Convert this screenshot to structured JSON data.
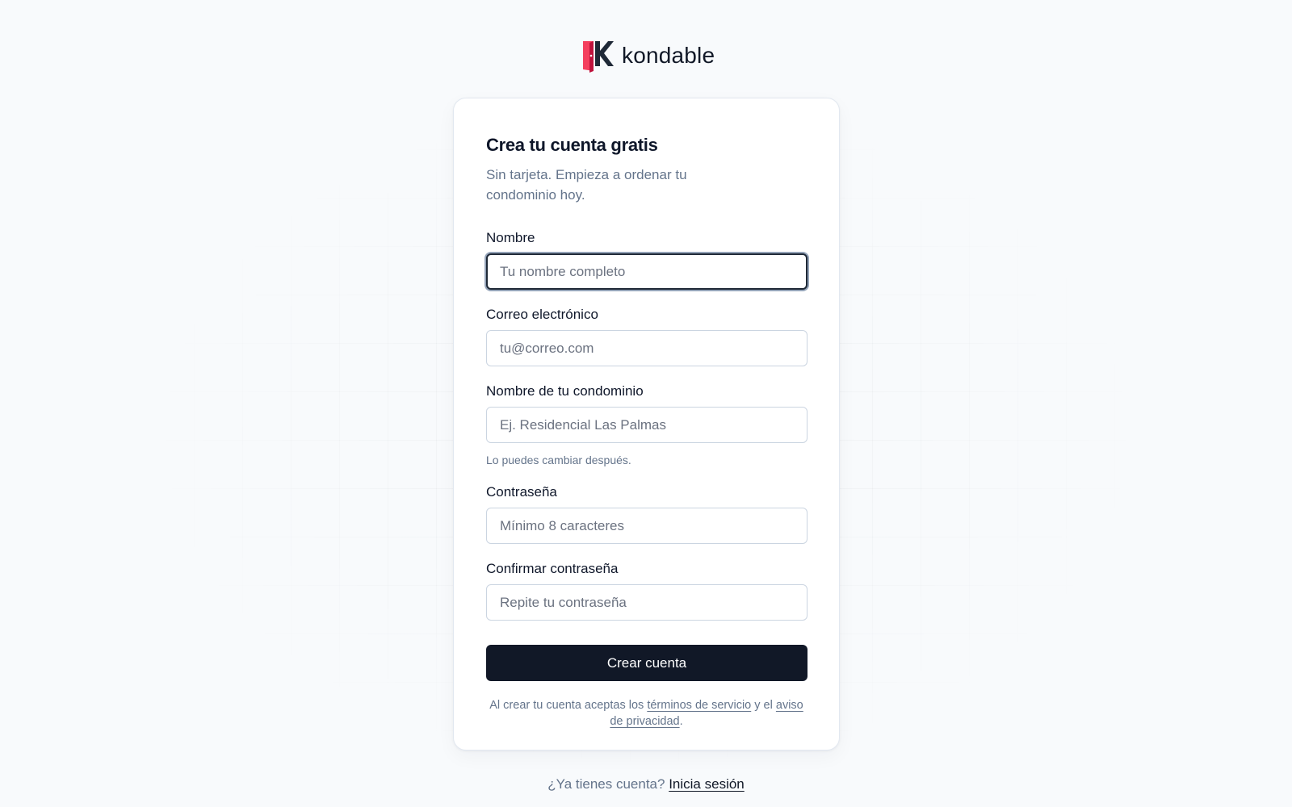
{
  "brand": {
    "name": "kondable",
    "colors": {
      "accent": "#f43f5e",
      "dark": "#111827"
    }
  },
  "card": {
    "title": "Crea tu cuenta gratis",
    "subtitle": "Sin tarjeta. Empieza a ordenar tu condominio hoy."
  },
  "form": {
    "fields": [
      {
        "label": "Nombre",
        "placeholder": "Tu nombre completo",
        "value": "",
        "focused": true
      },
      {
        "label": "Correo electrónico",
        "placeholder": "tu@correo.com",
        "value": ""
      },
      {
        "label": "Nombre de tu condominio",
        "placeholder": "Ej. Residencial Las Palmas",
        "value": "",
        "hint": "Lo puedes cambiar después."
      },
      {
        "label": "Contraseña",
        "placeholder": "Mínimo 8 caracteres",
        "value": ""
      },
      {
        "label": "Confirmar contraseña",
        "placeholder": "Repite tu contraseña",
        "value": ""
      }
    ],
    "submit_label": "Crear cuenta"
  },
  "legal": {
    "prefix": "Al crear tu cuenta aceptas los",
    "terms_link": "términos de servicio",
    "connector": "y el",
    "privacy_link": "aviso de privacidad",
    "suffix": "."
  },
  "footer": {
    "prompt": "¿Ya tienes cuenta?",
    "login_link": "Inicia sesión"
  }
}
